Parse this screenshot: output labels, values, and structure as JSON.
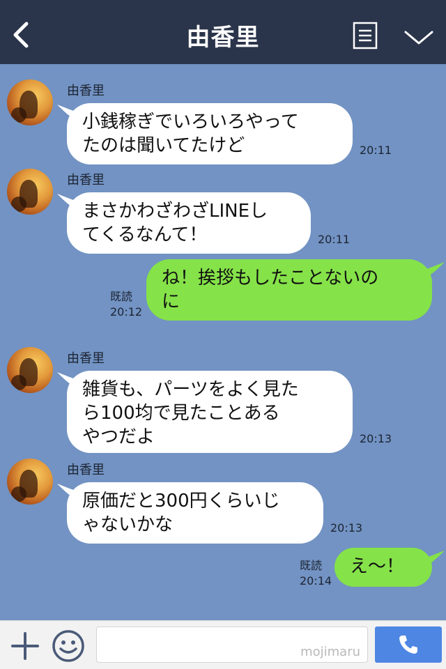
{
  "header": {
    "title": "由香里",
    "back_icon": "chevron-left-icon",
    "menu_icon": "document-menu-icon",
    "dropdown_icon": "chevron-down-icon"
  },
  "messages": [
    {
      "direction": "in",
      "sender": "由香里",
      "text": "小銭稼ぎでいろいろやって\nたのは聞いてたけど",
      "time": "20:11"
    },
    {
      "direction": "in",
      "sender": "由香里",
      "text": "まさかわざわざLINEし\nてくるなんて！",
      "time": "20:11"
    },
    {
      "direction": "out",
      "read": "既読",
      "text": "ね！挨拶もしたことないの\nに",
      "time": "20:12"
    },
    {
      "direction": "in",
      "sender": "由香里",
      "text": "雑貨も、パーツをよく見た\nら100均で見たことある\nやつだよ",
      "time": "20:13"
    },
    {
      "direction": "in",
      "sender": "由香里",
      "text": "原価だと300円くらいじ\nゃないかな",
      "time": "20:13"
    },
    {
      "direction": "out",
      "read": "既読",
      "text": "え〜！",
      "time": "20:14"
    }
  ],
  "footer": {
    "watermark": "mojimaru",
    "plus_icon": "plus-icon",
    "emoji_icon": "smile-icon",
    "call_icon": "phone-icon"
  },
  "colors": {
    "header_bg": "#2a344a",
    "chat_bg": "#7293c3",
    "incoming_bubble": "#ffffff",
    "outgoing_bubble": "#85e249",
    "call_button": "#4e86e4"
  }
}
